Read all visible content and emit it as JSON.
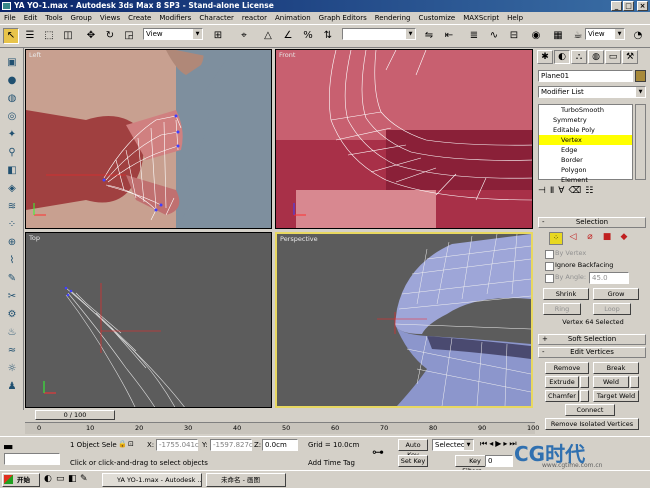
{
  "window": {
    "title": "YA YO-1.max - Autodesk 3ds Max 8 SP3  - Stand-alone License",
    "min": "_",
    "max": "□",
    "close": "×"
  },
  "menu": [
    "File",
    "Edit",
    "Tools",
    "Group",
    "Views",
    "Create",
    "Modifiers",
    "Character",
    "reactor",
    "Animation",
    "Graph Editors",
    "Rendering",
    "Customize",
    "MAXScript",
    "Help"
  ],
  "toolbar": {
    "view_combo": "View",
    "selection_set": ""
  },
  "viewports": {
    "left": "Left",
    "front": "Front",
    "top": "Top",
    "perspective": "Perspective"
  },
  "command_panel": {
    "object_name": "Plane01",
    "object_color": "#a88a3a",
    "modifier_list": "Modifier List",
    "stack": [
      {
        "label": "TurboSmooth",
        "selected": false
      },
      {
        "label": "Symmetry",
        "selected": false
      },
      {
        "label": "Editable Poly",
        "selected": false
      },
      {
        "label": "Vertex",
        "selected": true
      },
      {
        "label": "Edge",
        "selected": false
      },
      {
        "label": "Border",
        "selected": false
      },
      {
        "label": "Polygon",
        "selected": false
      },
      {
        "label": "Element",
        "selected": false
      }
    ],
    "selection": {
      "header": "Selection",
      "by_vertex": "By Vertex",
      "ignore_backfacing": "Ignore Backfacing",
      "by_angle": "By Angle:",
      "angle_value": "45.0",
      "shrink": "Shrink",
      "grow": "Grow",
      "ring": "Ring",
      "loop": "Loop",
      "status": "Vertex 64 Selected"
    },
    "soft_selection": "Soft Selection",
    "edit_vertices": {
      "header": "Edit Vertices",
      "remove": "Remove",
      "break": "Break",
      "extrude": "Extrude",
      "weld": "Weld",
      "chamfer": "Chamfer",
      "target_weld": "Target Weld",
      "connect": "Connect",
      "remove_isolated": "Remove Isolated Vertices"
    }
  },
  "timeline": {
    "slider": "0 / 100",
    "ticks": [
      "0",
      "10",
      "20",
      "30",
      "40",
      "50",
      "60",
      "70",
      "80",
      "90",
      "100"
    ]
  },
  "status": {
    "selection": "1 Object Sele",
    "x_label": "X:",
    "x": "-1755.041c",
    "y_label": "Y:",
    "y": "-1597.827c",
    "z_label": "Z:",
    "z": "0.0cm",
    "grid": "Grid = 10.0cm",
    "auto_key": "Auto Key",
    "selected": "Selected",
    "set_key": "Set Key",
    "key_filters": "Key Filters...",
    "prompt": "Click or click-and-drag to select objects",
    "add_time_tag": "Add Time Tag",
    "frame": "0"
  },
  "taskbar": {
    "start": "开始",
    "task1": "YA YO-1.max - Autodesk ...",
    "task2": "未命名 - 画图"
  },
  "watermark": {
    "text": "CG时代",
    "url": "www.cgtime.com.cn"
  }
}
